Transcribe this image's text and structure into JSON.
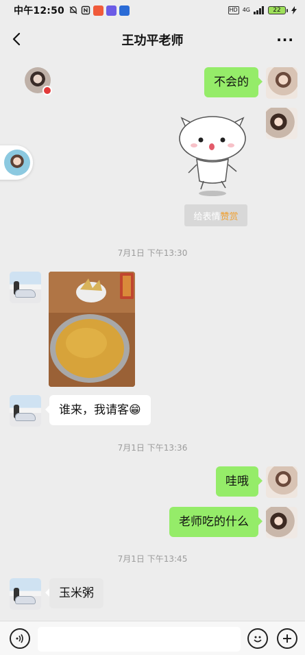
{
  "status_bar": {
    "time": "中午12:50",
    "network": "4G",
    "battery": "22",
    "hd_label": "HD"
  },
  "nav": {
    "title": "王功平老师"
  },
  "messages": {
    "m1": "不会的",
    "sticker_tag_prefix": "给表情",
    "sticker_tag_highlight": "赞赏",
    "ts1": "7月1日 下午13:30",
    "m2": "谁来，我请客😁",
    "ts2": "7月1日 下午13:36",
    "m3": "哇哦",
    "m4": "老师吃的什么",
    "ts3": "7月1日 下午13:45",
    "m5": "玉米粥"
  },
  "colors": {
    "sent_bubble": "#95ec69",
    "received_bubble": "#ffffff",
    "background": "#ededed"
  }
}
